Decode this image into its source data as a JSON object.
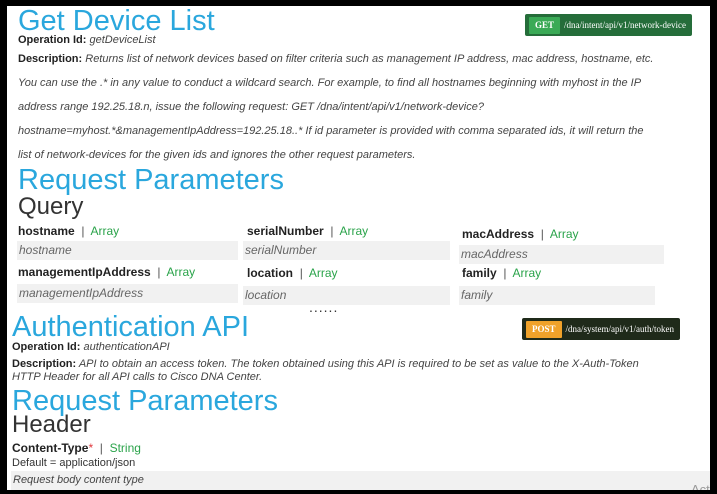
{
  "get_device_list": {
    "title": "Get Device List",
    "operation_label": "Operation Id:",
    "operation_id": "getDeviceList",
    "method": "GET",
    "path": "/dna/intent/api/v1/network-device",
    "description_label": "Description:",
    "description_lines": [
      "Returns list of network devices based on filter criteria such as management IP address, mac address, hostname, etc.",
      "You can use the .* in any value to conduct a wildcard search. For example, to find all hostnames beginning with myhost in the IP",
      "address range 192.25.18.n, issue the following request: GET /dna/intent/api/v1/network-device?",
      "hostname=myhost.*&managementIpAddress=192.25.18..* If id parameter is provided with comma separated ids, it will return the",
      "list of network-devices for the given ids and ignores the other request parameters."
    ],
    "request_parameters_title": "Request Parameters",
    "query_title": "Query",
    "params": [
      {
        "name": "hostname",
        "type": "Array",
        "placeholder": "hostname"
      },
      {
        "name": "serialNumber",
        "type": "Array",
        "placeholder": "serialNumber"
      },
      {
        "name": "macAddress",
        "type": "Array",
        "placeholder": "macAddress"
      },
      {
        "name": "managementIpAddress",
        "type": "Array",
        "placeholder": "managementIpAddress"
      },
      {
        "name": "location",
        "type": "Array",
        "placeholder": "location"
      },
      {
        "name": "family",
        "type": "Array",
        "placeholder": "family"
      }
    ],
    "ellipsis": "......"
  },
  "auth_api": {
    "title": "Authentication API",
    "operation_label": "Operation Id:",
    "operation_id": "authenticationAPI",
    "method": "POST",
    "path": "/dna/system/api/v1/auth/token",
    "description_label": "Description:",
    "description_lines": [
      "API to obtain an access token. The token obtained using this API is required to be set as value to the X-Auth-Token",
      "HTTP Header for all API calls to Cisco DNA Center."
    ],
    "request_parameters_title": "Request Parameters",
    "header_title": "Header",
    "header_param": {
      "name": "Content-Type",
      "required_mark": "*",
      "type": "String",
      "default_text": "Default = application/json",
      "body_hint": "Request body content type"
    }
  },
  "watermark": "Act",
  "colors": {
    "heading_blue": "#2aa7dd",
    "type_green": "#2aa34a",
    "get_green": "#3aaa56",
    "get_badge_bg": "#256d3a",
    "post_orange": "#f0a22a",
    "post_badge_bg": "#1f2a1a",
    "required_red": "#e0393e"
  }
}
